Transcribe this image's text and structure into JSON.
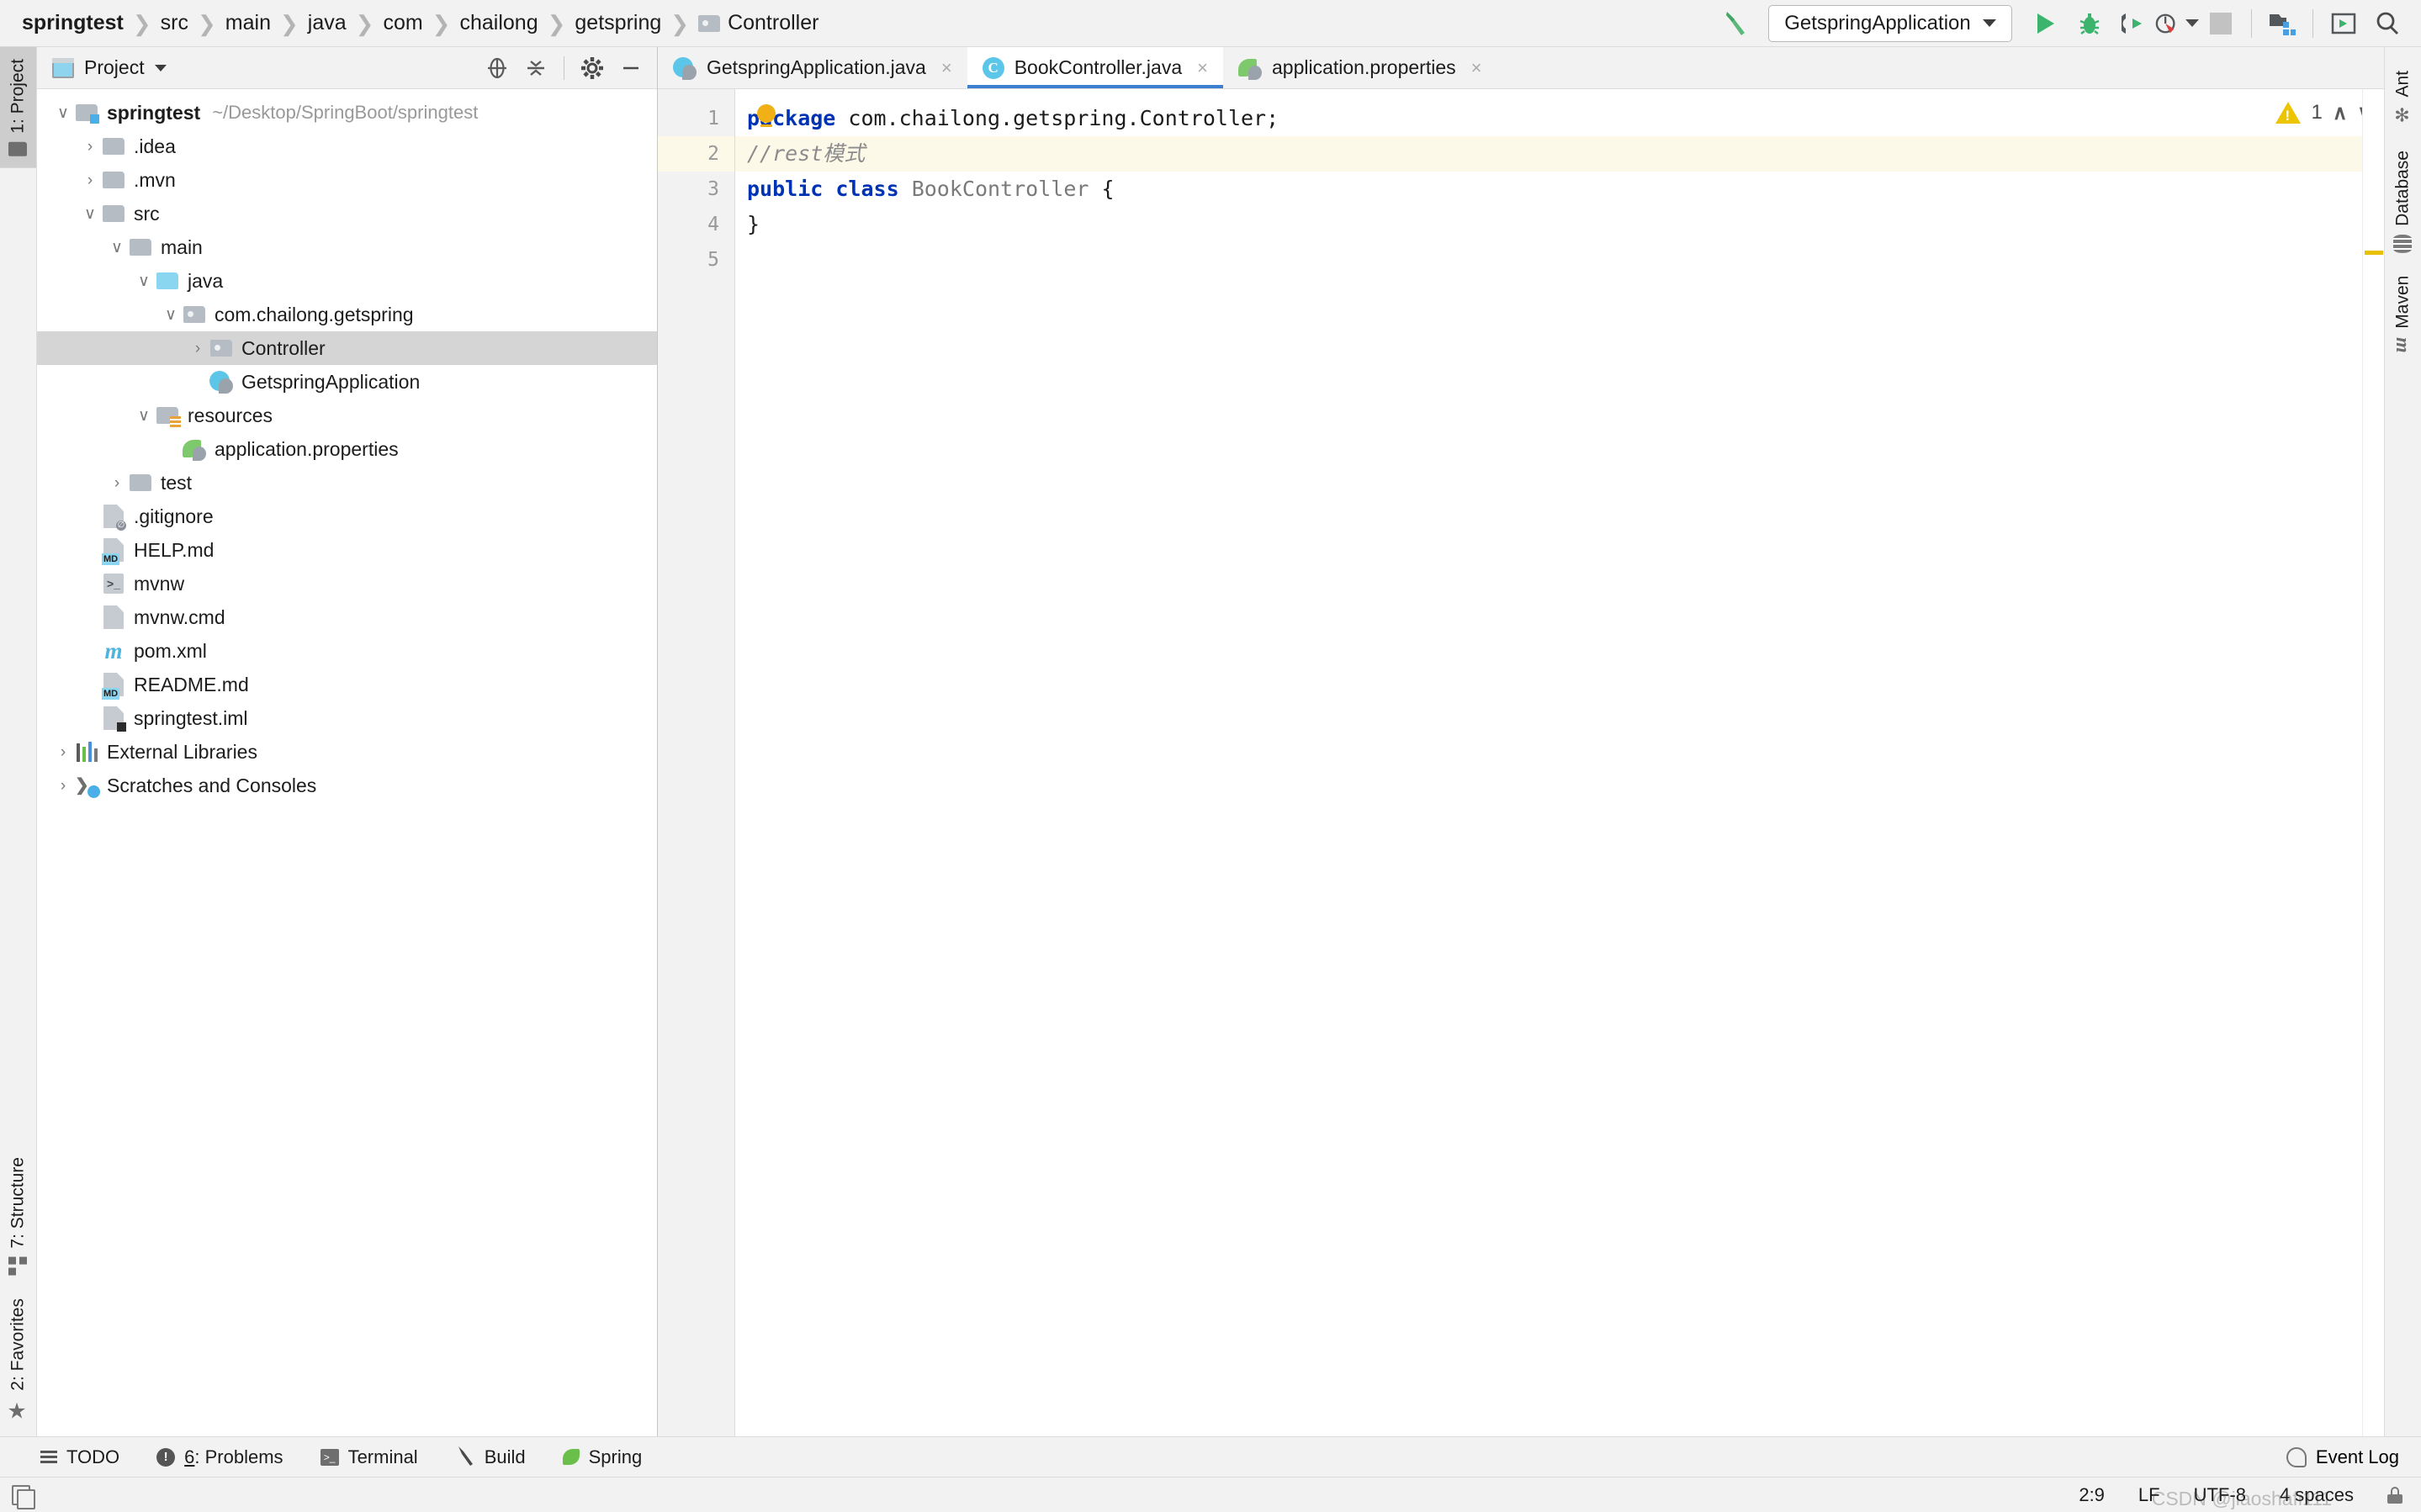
{
  "breadcrumb": {
    "items": [
      "springtest",
      "src",
      "main",
      "java",
      "com",
      "chailong",
      "getspring"
    ],
    "leaf": "Controller",
    "leaf_icon": "package-folder-icon"
  },
  "toolbar": {
    "build_icon": "hammer-icon",
    "run_config": "GetspringApplication",
    "run_icon": "run-icon",
    "debug_icon": "debug-icon",
    "run_coverage_icon": "run-with-coverage-icon",
    "profile_icon": "profiler-icon",
    "stop_icon": "stop-icon",
    "project_structure_icon": "project-structure-icon",
    "terminal_icon": "run-anything-icon",
    "search_icon": "search-everywhere-icon"
  },
  "left_rail": {
    "top": [
      {
        "label": "1: Project",
        "icon": "folder-icon",
        "active": true
      }
    ],
    "bottom": [
      {
        "label": "7: Structure",
        "icon": "structure-icon",
        "active": false
      },
      {
        "label": "2: Favorites",
        "icon": "star-icon",
        "active": false
      }
    ]
  },
  "right_rail": {
    "items": [
      {
        "label": "Ant",
        "icon": "ant-icon"
      },
      {
        "label": "Database",
        "icon": "database-icon"
      },
      {
        "label": "Maven",
        "icon": "maven-icon"
      }
    ]
  },
  "project_panel": {
    "title": "Project",
    "tools": [
      {
        "name": "select-opened-file-icon"
      },
      {
        "name": "collapse-all-icon"
      },
      {
        "name": "settings-gear-icon"
      },
      {
        "name": "hide-panel-icon"
      }
    ],
    "tree": [
      {
        "indent": 0,
        "arrow": "down",
        "icon": "module-folder-icon",
        "label": "springtest",
        "bold": true,
        "path": "~/Desktop/SpringBoot/springtest"
      },
      {
        "indent": 1,
        "arrow": "right",
        "icon": "folder-icon",
        "label": ".idea"
      },
      {
        "indent": 1,
        "arrow": "right",
        "icon": "folder-icon",
        "label": ".mvn"
      },
      {
        "indent": 1,
        "arrow": "down",
        "icon": "folder-icon",
        "label": "src"
      },
      {
        "indent": 2,
        "arrow": "down",
        "icon": "folder-icon",
        "label": "main"
      },
      {
        "indent": 3,
        "arrow": "down",
        "icon": "source-folder-icon",
        "label": "java"
      },
      {
        "indent": 4,
        "arrow": "down",
        "icon": "package-folder-icon",
        "label": "com.chailong.getspring"
      },
      {
        "indent": 5,
        "arrow": "right",
        "icon": "package-folder-icon",
        "label": "Controller",
        "selected": true
      },
      {
        "indent": 5,
        "arrow": "none",
        "icon": "spring-class-icon",
        "label": "GetspringApplication"
      },
      {
        "indent": 3,
        "arrow": "down",
        "icon": "resources-folder-icon",
        "label": "resources"
      },
      {
        "indent": 4,
        "arrow": "none",
        "icon": "spring-properties-icon",
        "label": "application.properties"
      },
      {
        "indent": 2,
        "arrow": "right",
        "icon": "folder-icon",
        "label": "test"
      },
      {
        "indent": 1,
        "arrow": "none",
        "icon": "gitignore-file-icon",
        "label": ".gitignore"
      },
      {
        "indent": 1,
        "arrow": "none",
        "icon": "markdown-file-icon",
        "label": "HELP.md"
      },
      {
        "indent": 1,
        "arrow": "none",
        "icon": "shell-script-icon",
        "label": "mvnw"
      },
      {
        "indent": 1,
        "arrow": "none",
        "icon": "cmd-file-icon",
        "label": "mvnw.cmd"
      },
      {
        "indent": 1,
        "arrow": "none",
        "icon": "maven-pom-icon",
        "label": "pom.xml"
      },
      {
        "indent": 1,
        "arrow": "none",
        "icon": "markdown-file-icon",
        "label": "README.md"
      },
      {
        "indent": 1,
        "arrow": "none",
        "icon": "iml-module-file-icon",
        "label": "springtest.iml"
      },
      {
        "indent": 0,
        "arrow": "right",
        "icon": "external-libraries-icon",
        "label": "External Libraries"
      },
      {
        "indent": 0,
        "arrow": "right",
        "icon": "scratches-icon",
        "label": "Scratches and Consoles"
      }
    ]
  },
  "editor": {
    "tabs": [
      {
        "label": "GetspringApplication.java",
        "icon": "spring-class-icon",
        "active": false,
        "close": "×"
      },
      {
        "label": "BookController.java",
        "icon": "java-class-icon",
        "active": true,
        "close": "×"
      },
      {
        "label": "application.properties",
        "icon": "spring-properties-icon",
        "active": false,
        "close": "×"
      }
    ],
    "gutter": [
      "1",
      "2",
      "3",
      "4",
      "5"
    ],
    "current_line": 2,
    "intention_bulb_icon": "intention-bulb-icon",
    "lines": [
      {
        "n": 1,
        "tokens": [
          {
            "t": "package",
            "c": "kw"
          },
          {
            "t": " com.chailong.getspring.Controller;",
            "c": "plain"
          }
        ]
      },
      {
        "n": 2,
        "tokens": [
          {
            "t": "//rest模式",
            "c": "cmt"
          }
        ]
      },
      {
        "n": 3,
        "tokens": [
          {
            "t": "public",
            "c": "kw"
          },
          {
            "t": " ",
            "c": "plain"
          },
          {
            "t": "class",
            "c": "kw"
          },
          {
            "t": " ",
            "c": "plain"
          },
          {
            "t": "BookController",
            "c": "cls"
          },
          {
            "t": " {",
            "c": "plain"
          }
        ]
      },
      {
        "n": 4,
        "tokens": [
          {
            "t": "}",
            "c": "plain"
          }
        ]
      },
      {
        "n": 5,
        "tokens": []
      }
    ],
    "inspection": {
      "warning_icon": "warning-triangle-icon",
      "warning_count": "1",
      "prev_icon": "∧",
      "next_icon": "∨"
    }
  },
  "tool_window_bar": {
    "items": [
      {
        "label": "TODO",
        "mnemonic": "",
        "icon": "todo-icon"
      },
      {
        "label": ": Problems",
        "mnemonic": "6",
        "icon": "problems-icon"
      },
      {
        "label": "Terminal",
        "mnemonic": "",
        "icon": "terminal-icon"
      },
      {
        "label": "Build",
        "mnemonic": "",
        "icon": "build-hammer-icon"
      },
      {
        "label": "Spring",
        "mnemonic": "",
        "icon": "spring-leaf-icon"
      }
    ],
    "event_log": {
      "label": "Event Log",
      "icon": "event-log-icon"
    }
  },
  "status_bar": {
    "pages_icon": "pages-icon",
    "caret_position": "2:9",
    "line_separator": "LF",
    "encoding": "UTF-8",
    "indent": "4 spaces",
    "lock_icon": "read-only-lock-icon",
    "watermark": "CSDN @jiaoshafi111"
  }
}
